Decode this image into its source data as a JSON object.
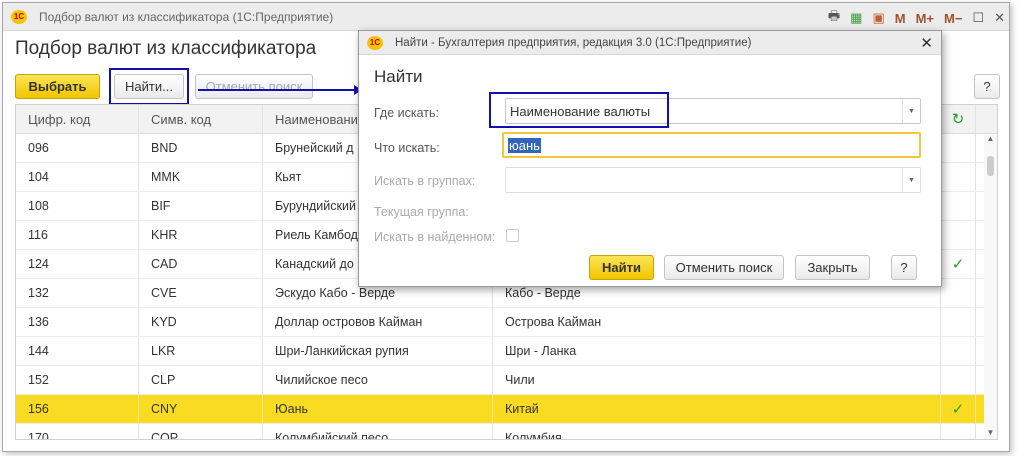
{
  "window": {
    "title": "Подбор валют из классификатора  (1С:Предприятие)",
    "logo": "1С",
    "toolbar": {
      "m": "M",
      "mplus": "M+",
      "mminus": "M−"
    }
  },
  "page_title": "Подбор валют из классификатора",
  "toolbar": {
    "select": "Выбрать",
    "find": "Найти...",
    "cancel_search": "Отменить поиск",
    "help": "?"
  },
  "table": {
    "headers": [
      "Цифр. код",
      "Симв. код",
      "Наименовани"
    ],
    "rows": [
      {
        "code": "096",
        "sym": "BND",
        "name": "Брунейский д",
        "country": "",
        "check": ""
      },
      {
        "code": "104",
        "sym": "MMK",
        "name": "Кьят",
        "country": "",
        "check": ""
      },
      {
        "code": "108",
        "sym": "BIF",
        "name": "Бурундийский",
        "country": "",
        "check": ""
      },
      {
        "code": "116",
        "sym": "KHR",
        "name": "Риель Камбод",
        "country": "",
        "check": ""
      },
      {
        "code": "124",
        "sym": "CAD",
        "name": "Канадский до",
        "country": "",
        "check": "✓"
      },
      {
        "code": "132",
        "sym": "CVE",
        "name": "Эскудо Кабо - Верде",
        "country": "Кабо - Верде",
        "check": ""
      },
      {
        "code": "136",
        "sym": "KYD",
        "name": "Доллар островов Кайман",
        "country": "Острова Кайман",
        "check": ""
      },
      {
        "code": "144",
        "sym": "LKR",
        "name": "Шри-Ланкийская рупия",
        "country": "Шри - Ланка",
        "check": ""
      },
      {
        "code": "152",
        "sym": "CLP",
        "name": "Чилийское песо",
        "country": "Чили",
        "check": ""
      },
      {
        "code": "156",
        "sym": "CNY",
        "name": "Юань",
        "country": "Китай",
        "check": "✓",
        "selected": true
      },
      {
        "code": "170",
        "sym": "COP",
        "name": "Колумбийский песо",
        "country": "Колумбия",
        "check": ""
      }
    ]
  },
  "dialog": {
    "title": "Найти - Бухгалтерия предприятия, редакция 3.0  (1С:Предприятие)",
    "heading": "Найти",
    "where_label": "Где искать:",
    "where_value": "Наименование валюты",
    "what_label": "Что искать:",
    "what_value": "юань",
    "groups_label": "Искать в группах:",
    "current_group_label": "Текущая группа:",
    "in_found_label": "Искать в найденном:",
    "find": "Найти",
    "cancel": "Отменить поиск",
    "close": "Закрыть",
    "help": "?"
  },
  "colors": {
    "accent": "#f2c500",
    "highlight": "#1010b0",
    "check": "#2a9a2a"
  }
}
